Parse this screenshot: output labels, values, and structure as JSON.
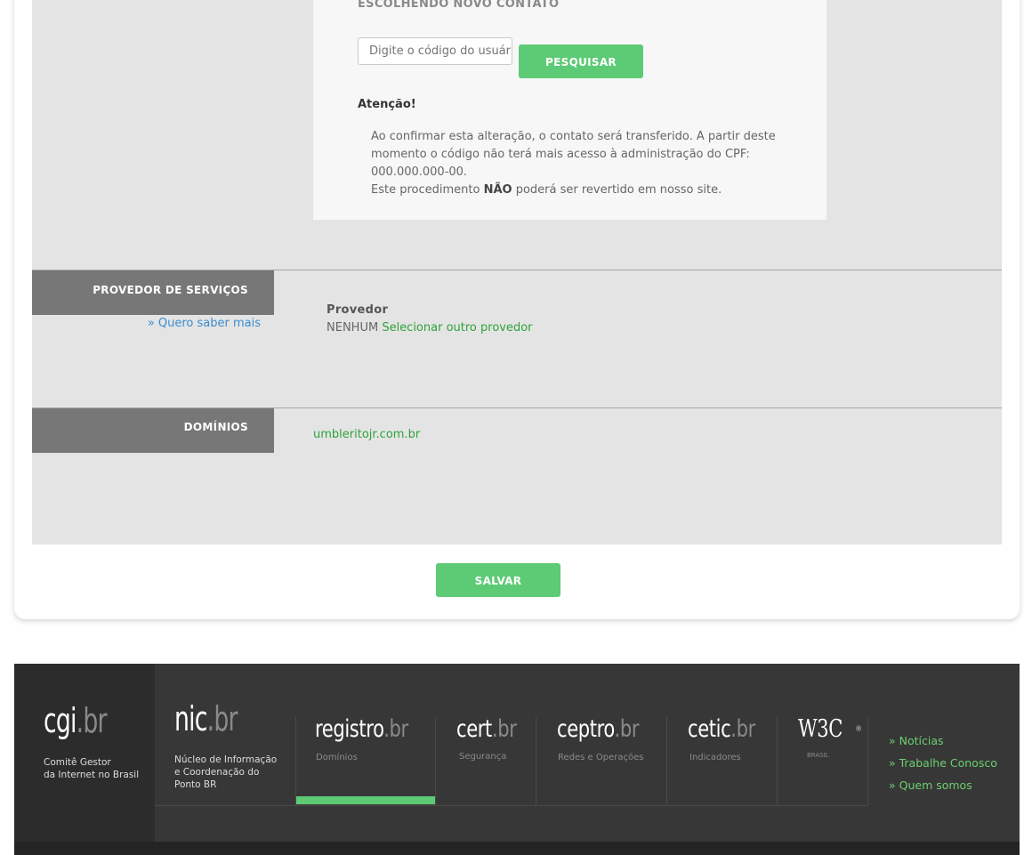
{
  "contact": {
    "title": "ESCOLHENDO NOVO CONTATO",
    "search_placeholder": "Digite o código do usuário",
    "search_button": "PESQUISAR",
    "attention_title": "Atenção!",
    "attention_line1": "Ao confirmar esta alteração, o contato será transferido. A partir deste momento o código não terá mais acesso à administração do CPF: 000.000.000-00.",
    "attention_line2_pre": "Este procedimento ",
    "attention_line2_bold": "NÃO",
    "attention_line2_post": " poderá ser revertido em nosso site."
  },
  "provider_section": {
    "label": "PROVEDOR DE SERVIÇOS",
    "more_link": "» Quero saber mais",
    "field_title": "Provedor",
    "value": "NENHUM",
    "change_link": "Selecionar outro provedor"
  },
  "domains_section": {
    "label": "DOMÍNIOS",
    "domain": "umbleritojr.com.br"
  },
  "save_button": "SALVAR",
  "footer": {
    "cgi": {
      "logo_main": "cgi",
      "logo_suffix": "br",
      "caption_1": "Comitê Gestor",
      "caption_2": "da Internet no Brasil"
    },
    "nic": {
      "logo_main": "nic",
      "logo_suffix": "br",
      "caption_1": "Núcleo de Informação",
      "caption_2": "e Coordenação do",
      "caption_3": "Ponto BR"
    },
    "registro": {
      "logo_main": "registro",
      "logo_suffix": "br",
      "caption": "Domínios"
    },
    "cert": {
      "logo_main": "cert",
      "logo_suffix": "br",
      "caption": "Segurança"
    },
    "ceptro": {
      "logo_main": "ceptro",
      "logo_suffix": "br",
      "caption": "Redes e Operações"
    },
    "cetic": {
      "logo_main": "cetic",
      "logo_suffix": "br",
      "caption": "Indicadores"
    },
    "w3c": {
      "logo_main": "W3C",
      "caption": "BRASIL"
    },
    "links": [
      "» Notícias",
      "» Trabalhe Conosco",
      "» Quem somos"
    ]
  },
  "colors": {
    "accent": "#5dca75",
    "link_green": "#2da33c",
    "link_blue": "#3b8dd0",
    "footer_bg": "#373737"
  }
}
